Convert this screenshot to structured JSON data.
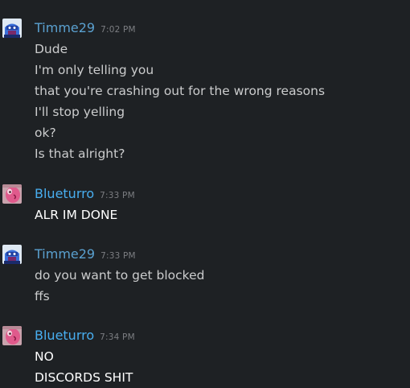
{
  "colors": {
    "background": "#1e2124",
    "timme_name": "#5aa0cf",
    "blueturro_name": "#48aef0",
    "timme_text": "#cbcccd",
    "blueturro_text": "#ffffff",
    "timestamp": "#7c7e82"
  },
  "messages": [
    {
      "author": "Timme29",
      "time": "7:02 PM",
      "avatar_icon": "blue-robot-avatar-icon",
      "lines": [
        "Dude",
        "I'm only telling you",
        "that you're crashing out for the wrong reasons",
        "I'll stop yelling",
        "ok?",
        "Is that alright?"
      ]
    },
    {
      "author": "Blueturro",
      "time": "7:33 PM",
      "avatar_icon": "pink-creature-avatar-icon",
      "lines": [
        "ALR IM DONE"
      ]
    },
    {
      "author": "Timme29",
      "time": "7:33 PM",
      "avatar_icon": "blue-robot-avatar-icon",
      "lines": [
        "do you want to get blocked",
        "ffs"
      ]
    },
    {
      "author": "Blueturro",
      "time": "7:34 PM",
      "avatar_icon": "pink-creature-avatar-icon",
      "lines": [
        "NO",
        "DISCORDS SHIT"
      ]
    }
  ]
}
